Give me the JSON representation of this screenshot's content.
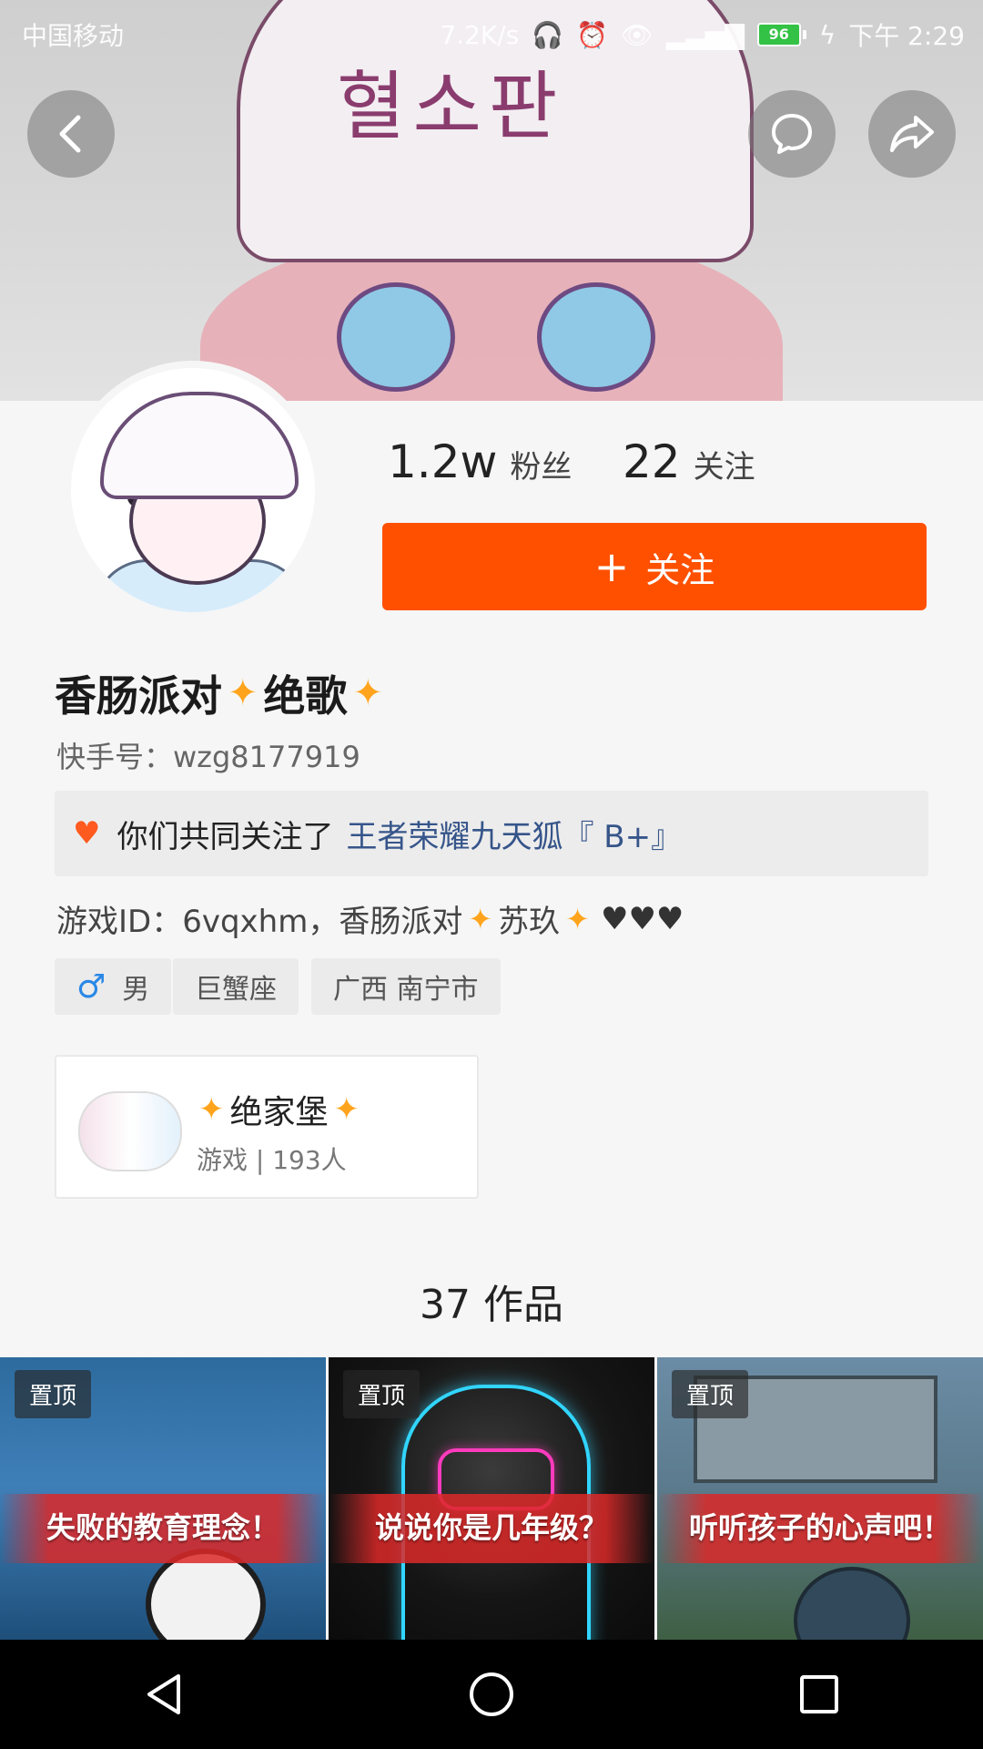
{
  "status_bar": {
    "carrier": "中国移动",
    "network_speed": "7.2K/s",
    "battery_level": "96",
    "time": "下午 2:29"
  },
  "header": {
    "cap_text": "혈소판"
  },
  "profile": {
    "followers_count": "1.2w",
    "followers_label": "粉丝",
    "following_count": "22",
    "following_label": "关注",
    "follow_button_label": "关注",
    "name_part1": "香肠派对",
    "name_part2": "绝歌",
    "kuaishou_id": "快手号：wzg8177919",
    "mutual_prefix": "你们共同关注了",
    "mutual_user": "王者荣耀九天狐『 B+』",
    "bio_text": "游戏ID：6vqxhm，香肠派对",
    "bio_suffix": "苏玖",
    "tags": [
      "男",
      "巨蟹座",
      "广西 南宁市"
    ],
    "sparkle_icon": "sparkle-icon",
    "accent_color": "#ff5000"
  },
  "group": {
    "name": "绝家堡",
    "meta": "游戏 | 193人"
  },
  "works": {
    "title": "37 作品",
    "tiles": [
      {
        "pin": "置顶",
        "caption": "失败的教育理念！"
      },
      {
        "pin": "置顶",
        "caption": "说说你是几年级？"
      },
      {
        "pin": "置顶",
        "caption": "听听孩子的心声吧！"
      }
    ]
  }
}
